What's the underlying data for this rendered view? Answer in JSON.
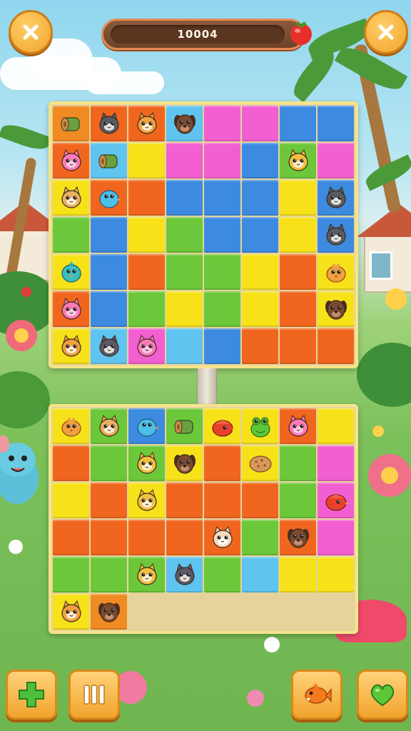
{
  "score": {
    "value": "10004"
  },
  "buttons": {
    "close_left": "close-icon",
    "close_right": "close-icon",
    "add": "plus-icon",
    "pause": "pause-icon",
    "fish": "fish-icon",
    "heart": "heart-icon"
  },
  "colors": {
    "red": "#f0661e",
    "blue": "#3d8be0",
    "yellow": "#f7e21a",
    "pink": "#f25fd0",
    "green": "#6cc83a",
    "orange": "#f08a22",
    "cyan": "#5fc4f0",
    "empty": "#e9e1c6"
  },
  "top_board": {
    "rows": [
      [
        [
          "orange",
          "log"
        ],
        [
          "red",
          "cat-grey"
        ],
        [
          "red",
          "cat-orange"
        ],
        [
          "cyan",
          "dog-brown"
        ],
        [
          "pink",
          ""
        ],
        [
          "pink",
          ""
        ],
        [
          "blue",
          ""
        ],
        [
          "blue",
          ""
        ]
      ],
      [
        [
          "red",
          "cat-pink"
        ],
        [
          "cyan",
          "log"
        ],
        [
          "yellow",
          ""
        ],
        [
          "pink",
          ""
        ],
        [
          "pink",
          ""
        ],
        [
          "blue",
          ""
        ],
        [
          "green",
          "cat-yellow"
        ],
        [
          "pink",
          ""
        ]
      ],
      [
        [
          "yellow",
          "cat-tan"
        ],
        [
          "red",
          "bird-blue"
        ],
        [
          "red",
          ""
        ],
        [
          "blue",
          ""
        ],
        [
          "blue",
          ""
        ],
        [
          "blue",
          ""
        ],
        [
          "yellow",
          ""
        ],
        [
          "blue",
          "cat-grey"
        ]
      ],
      [
        [
          "green",
          ""
        ],
        [
          "blue",
          ""
        ],
        [
          "yellow",
          ""
        ],
        [
          "green",
          ""
        ],
        [
          "blue",
          ""
        ],
        [
          "blue",
          ""
        ],
        [
          "yellow",
          ""
        ],
        [
          "blue",
          "cat-grey"
        ]
      ],
      [
        [
          "yellow",
          "bird-teal"
        ],
        [
          "blue",
          ""
        ],
        [
          "red",
          ""
        ],
        [
          "green",
          ""
        ],
        [
          "green",
          ""
        ],
        [
          "yellow",
          ""
        ],
        [
          "red",
          ""
        ],
        [
          "yellow",
          "bird-orange"
        ]
      ],
      [
        [
          "red",
          "cat-pink"
        ],
        [
          "blue",
          ""
        ],
        [
          "green",
          ""
        ],
        [
          "yellow",
          ""
        ],
        [
          "green",
          ""
        ],
        [
          "yellow",
          ""
        ],
        [
          "red",
          ""
        ],
        [
          "yellow",
          "dog-brown"
        ]
      ],
      [
        [
          "yellow",
          "cat-orange"
        ],
        [
          "cyan",
          "cat-grey"
        ],
        [
          "pink",
          "cat-pink"
        ],
        [
          "cyan",
          ""
        ],
        [
          "blue",
          ""
        ],
        [
          "red",
          ""
        ],
        [
          "red",
          ""
        ],
        [
          "red",
          ""
        ]
      ]
    ]
  },
  "bottom_board": {
    "rows": [
      [
        [
          "yellow",
          "bird-orange"
        ],
        [
          "green",
          "cat-tan"
        ],
        [
          "blue",
          "bird-blue"
        ],
        [
          "green",
          "log"
        ],
        [
          "yellow",
          "bird-red"
        ],
        [
          "yellow",
          "frog"
        ],
        [
          "red",
          "cat-pink"
        ],
        [
          "yellow",
          ""
        ]
      ],
      [
        [
          "red",
          ""
        ],
        [
          "green",
          ""
        ],
        [
          "green",
          "cat-yellow"
        ],
        [
          "yellow",
          "dog-brown"
        ],
        [
          "red",
          ""
        ],
        [
          "yellow",
          "cookie"
        ],
        [
          "green",
          ""
        ],
        [
          "pink",
          ""
        ]
      ],
      [
        [
          "yellow",
          ""
        ],
        [
          "red",
          ""
        ],
        [
          "yellow",
          "cat-yellow"
        ],
        [
          "red",
          ""
        ],
        [
          "red",
          ""
        ],
        [
          "red",
          ""
        ],
        [
          "green",
          ""
        ],
        [
          "pink",
          "bird-red"
        ]
      ],
      [
        [
          "red",
          ""
        ],
        [
          "red",
          ""
        ],
        [
          "red",
          ""
        ],
        [
          "red",
          ""
        ],
        [
          "red",
          "cat-cream"
        ],
        [
          "green",
          ""
        ],
        [
          "red",
          "dog-brown"
        ],
        [
          "pink",
          ""
        ]
      ],
      [
        [
          "green",
          ""
        ],
        [
          "green",
          ""
        ],
        [
          "green",
          "cat-yellow"
        ],
        [
          "cyan",
          "cat-grey"
        ],
        [
          "green",
          ""
        ],
        [
          "cyan",
          ""
        ],
        [
          "yellow",
          ""
        ],
        [
          "yellow",
          ""
        ]
      ],
      [
        [
          "yellow",
          "cat-orange"
        ],
        [
          "orange",
          "dog-brown"
        ],
        [
          "empty",
          ""
        ],
        [
          "empty",
          ""
        ],
        [
          "empty",
          ""
        ],
        [
          "empty",
          ""
        ],
        [
          "empty",
          ""
        ],
        [
          "empty",
          ""
        ]
      ]
    ]
  }
}
